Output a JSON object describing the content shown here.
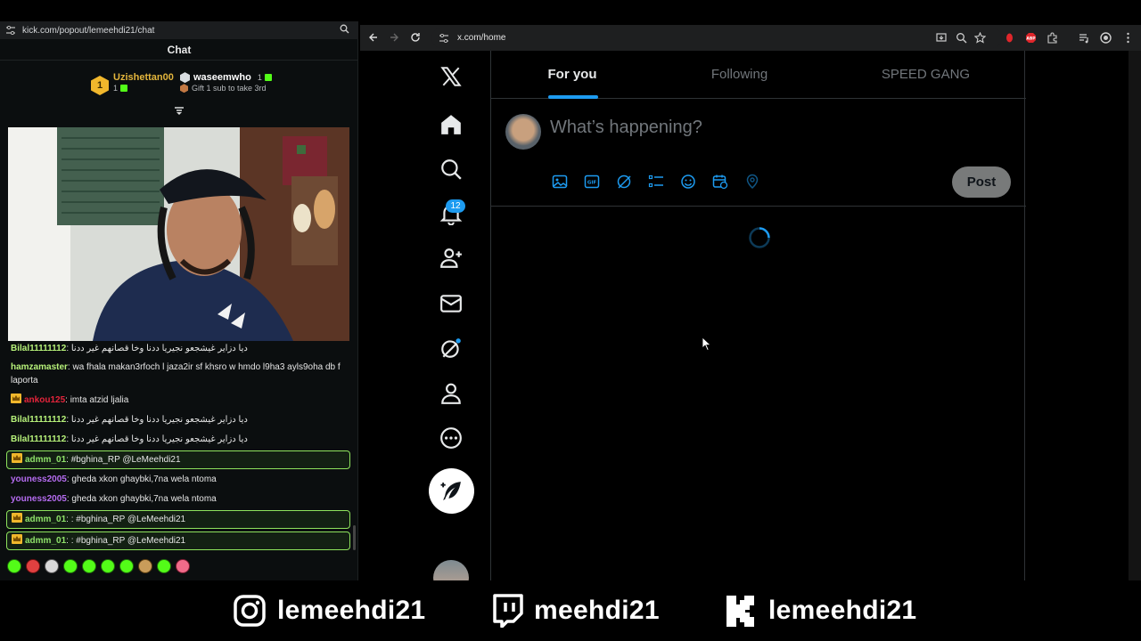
{
  "kick": {
    "url": "kick.com/popout/lemeehdi21/chat",
    "header": "Chat",
    "leaderboard": [
      {
        "rank": "1",
        "name": "Uzishettan00",
        "count": "1",
        "color": "#e3b53c"
      },
      {
        "rank": "2",
        "name": "waseemwho",
        "count": "1",
        "color": "#ffffff"
      },
      {
        "rank": "3",
        "name": "",
        "count": "",
        "subtitle": "Gift 1 sub to take 3rd"
      }
    ],
    "messages": [
      {
        "user": "Bilal11111112",
        "sep": ":",
        "text": "ديا دزاير غيشجعو نجيريا ددنا وخا قصانهم غير ددنا",
        "color": "#b7f27a",
        "badge": false,
        "highlight": false
      },
      {
        "user": "hamzamaster",
        "sep": ":",
        "text": "wa fhala makan3rfoch l jaza2ir sf khsro w hmdo l9ha3 ayls9oha db f laporta",
        "color": "#b7f27a",
        "badge": false,
        "highlight": false
      },
      {
        "user": "ankou125",
        "sep": ":",
        "text": "imta atzid ljalia",
        "color": "#e5243b",
        "badge": true,
        "highlight": false
      },
      {
        "user": "Bilal11111112",
        "sep": ":",
        "text": "ديا دزاير غيشجعو نجيريا ددنا وخا قصانهم غير ددنا",
        "color": "#b7f27a",
        "badge": false,
        "highlight": false
      },
      {
        "user": "Bilal11111112",
        "sep": ":",
        "text": "ديا دزاير غيشجعو نجيريا ددنا وخا قصانهم غير ددنا",
        "color": "#b7f27a",
        "badge": false,
        "highlight": false
      },
      {
        "user": "admm_01",
        "sep": ":",
        "text": "#bghina_RP @LeMeehdi21",
        "color": "#8fe36a",
        "badge": true,
        "highlight": true
      },
      {
        "user": "youness2005",
        "sep": ":",
        "text": "gheda xkon ghaybki,7na wela ntoma",
        "color": "#b56cf0",
        "badge": false,
        "highlight": false
      },
      {
        "user": "youness2005",
        "sep": ":",
        "text": "gheda xkon ghaybki,7na wela ntoma",
        "color": "#b56cf0",
        "badge": false,
        "highlight": false
      },
      {
        "user": "admm_01",
        "sep": ": :",
        "text": "#bghina_RP @LeMeehdi21",
        "color": "#8fe36a",
        "badge": true,
        "highlight": true
      },
      {
        "user": "admm_01",
        "sep": ": :",
        "text": "#bghina_RP @LeMeehdi21",
        "color": "#8fe36a",
        "badge": true,
        "highlight": true
      }
    ]
  },
  "browser": {
    "url": "x.com/home"
  },
  "x": {
    "notifications_count": "12",
    "tabs": [
      "For you",
      "Following",
      "SPEED GANG"
    ],
    "composer_placeholder": "What’s happening?",
    "post_label": "Post",
    "accent": "#1d9bf0"
  },
  "socials": [
    {
      "icon": "instagram-icon",
      "handle": "lemeehdi21"
    },
    {
      "icon": "twitch-icon",
      "handle": "meehdi21"
    },
    {
      "icon": "kick-icon",
      "handle": "lemeehdi21"
    }
  ]
}
